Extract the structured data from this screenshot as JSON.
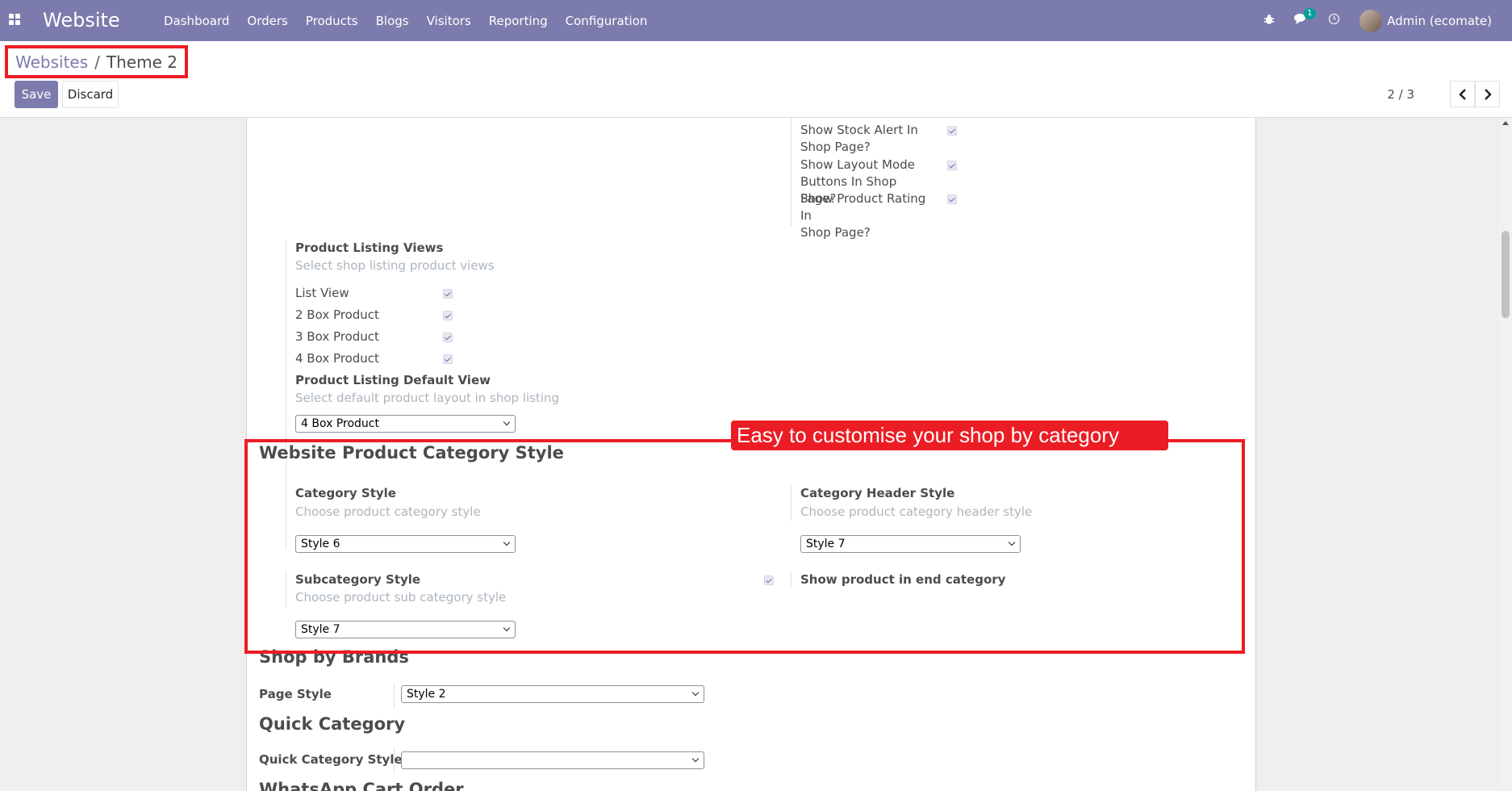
{
  "navbar": {
    "brand": "Website",
    "menu": [
      "Dashboard",
      "Orders",
      "Products",
      "Blogs",
      "Visitors",
      "Reporting",
      "Configuration"
    ],
    "messages_badge": "1",
    "user": "Admin (ecomate)",
    "icons": [
      "apps-grid-icon",
      "bug-icon",
      "chat-icon",
      "clock-icon"
    ]
  },
  "control_panel": {
    "breadcrumb_parent": "Websites",
    "breadcrumb_sep": "/",
    "breadcrumb_current": "Theme 2",
    "save_label": "Save",
    "discard_label": "Discard",
    "pager": "2 / 3"
  },
  "shop_options": {
    "stock_alert_1": "Show Stock Alert In",
    "stock_alert_2": "Shop Page?",
    "layout_mode_1": "Show Layout Mode",
    "layout_mode_2": "Buttons In Shop Page?",
    "rating_1": "Show Product Rating In",
    "rating_2": "Shop Page?"
  },
  "listing_views": {
    "title": "Product Listing Views",
    "hint": "Select shop listing product views",
    "options": [
      "List View",
      "2 Box Product",
      "3 Box Product",
      "4 Box Product"
    ]
  },
  "default_view": {
    "title": "Product Listing Default View",
    "hint": "Select default product layout in shop listing",
    "value": "4 Box Product"
  },
  "category_section": {
    "heading": "Website Product Category Style",
    "callout": "Easy to customise your shop by category page",
    "category_style": {
      "title": "Category Style",
      "hint": "Choose product category style",
      "value": "Style 6"
    },
    "category_header_style": {
      "title": "Category Header Style",
      "hint": "Choose product category header style",
      "value": "Style 7"
    },
    "subcategory_style": {
      "title": "Subcategory Style",
      "hint": "Choose product sub category style",
      "value": "Style 7"
    },
    "end_category": {
      "title": "Show product in end category"
    }
  },
  "brands": {
    "heading": "Shop by Brands",
    "page_style_label": "Page Style",
    "page_style_value": "Style 2"
  },
  "quick_category": {
    "heading": "Quick Category",
    "style_label": "Quick Category Style",
    "style_value": ""
  },
  "whatsapp": {
    "heading": "WhatsApp Cart Order"
  }
}
